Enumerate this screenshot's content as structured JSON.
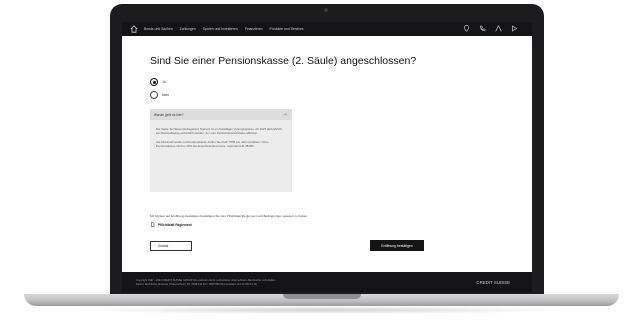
{
  "nav": {
    "items": [
      "Bonds und Sachen",
      "Zahlungen",
      "Sparen und Investieren",
      "Finanzieren",
      "Produkte und Services"
    ]
  },
  "question": {
    "title": "Sind Sie einer Pensionskasse (2. Säule) angeschlossen?",
    "options": [
      {
        "label": "Ja",
        "selected": true
      },
      {
        "label": "Nein",
        "selected": false
      }
    ]
  },
  "info": {
    "title": "Warum geht es hier?",
    "paragraph1": "Die Säule 3a (Steuerprivilegiertes Sparen) ist ein freiwilliges Vorsorgesparen. Ab 2023 darf jährlich ein Maximalbetrag einbezahlt werden, der vom Pensionskassenstatus abhängt.",
    "paragraph2": "Als Arbeitnehmende mit Pensionskasse dürfen Sie CHF 7'056 pro Jahr einzahlen. Ohne Pensionskasse sind es 20% des Erwerbseinkommens, maximal CHF 35'280."
  },
  "consent": {
    "text": "Mit Klicken auf Eröffnung bestätigen bestätigen Sie das Pflichtblatt Reglement und Bedingungen gelesen zu haben.",
    "link": "Pflichtblatt Reglement"
  },
  "buttons": {
    "back": "Zurück",
    "confirm": "Eröffnung bestätigen"
  },
  "footer": {
    "line1": "Copyright 1997 - 2023 CREDIT SUISSE GROUP AG und/oder mit ihr verbundene Unternehmen. Alle Rechte vorbehalten.",
    "line2": "Recht | Rechtliche Hinweise | Datenschutz | Tel. 0848 111 111 / 0848 880 844 (Ausland +41 44 333 11 11)",
    "logo": "CREDIT SUISSE"
  },
  "icons": {
    "home": "home-icon",
    "location": "location-pin-icon",
    "phone": "phone-icon",
    "user": "user-icon",
    "logout": "logout-icon",
    "chevron": "chevron-up-icon",
    "document": "document-icon"
  },
  "colors": {
    "nav_bg": "#141416",
    "primary_button": "#141414",
    "info_bg": "#ececec"
  }
}
